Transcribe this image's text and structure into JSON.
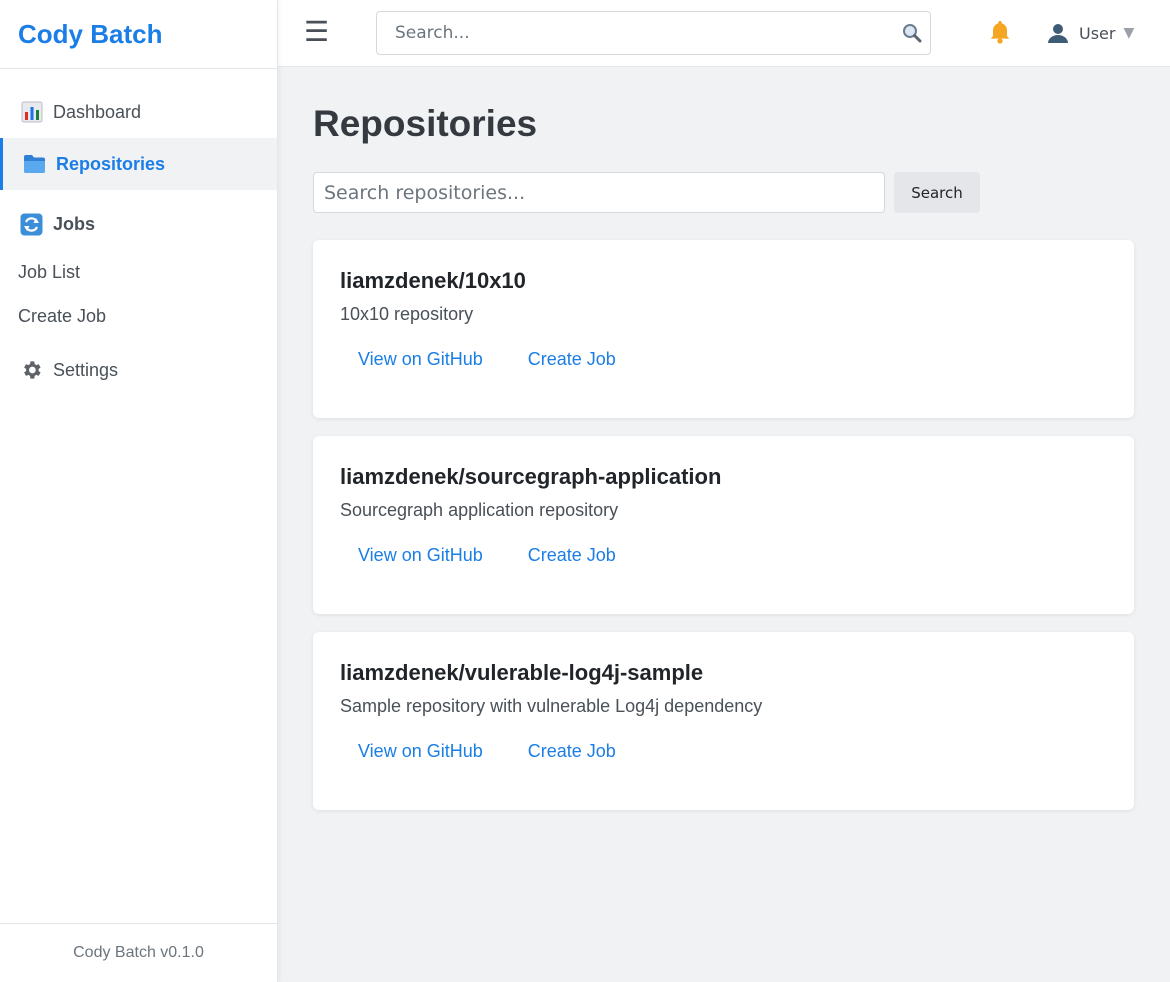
{
  "app": {
    "title": "Cody Batch",
    "footer": "Cody Batch v0.1.0",
    "accent_color": "#1a7ee6"
  },
  "sidebar": {
    "items": [
      {
        "label": "Dashboard",
        "icon": "bar-chart-icon",
        "active": false
      },
      {
        "label": "Repositories",
        "icon": "folder-icon",
        "active": true
      }
    ],
    "jobs_group": {
      "label": "Jobs",
      "icon": "refresh-icon",
      "children": [
        "Job List",
        "Create Job"
      ]
    },
    "settings": {
      "label": "Settings",
      "icon": "gear-icon"
    }
  },
  "topbar": {
    "menu_icon": "hamburger-icon",
    "search_placeholder": "Search...",
    "notification_icon": "bell-icon",
    "user_label": "User",
    "user_caret": "▼"
  },
  "main": {
    "title": "Repositories",
    "search_placeholder": "Search repositories...",
    "search_button": "Search",
    "repositories": [
      {
        "name": "liamzdenek/10x10",
        "description": "10x10 repository",
        "github_label": "View on GitHub",
        "job_label": "Create Job"
      },
      {
        "name": "liamzdenek/sourcegraph-application",
        "description": "Sourcegraph application repository",
        "github_label": "View on GitHub",
        "job_label": "Create Job"
      },
      {
        "name": "liamzdenek/vulerable-log4j-sample",
        "description": "Sample repository with vulnerable Log4j dependency",
        "github_label": "View on GitHub",
        "job_label": "Create Job"
      }
    ]
  }
}
